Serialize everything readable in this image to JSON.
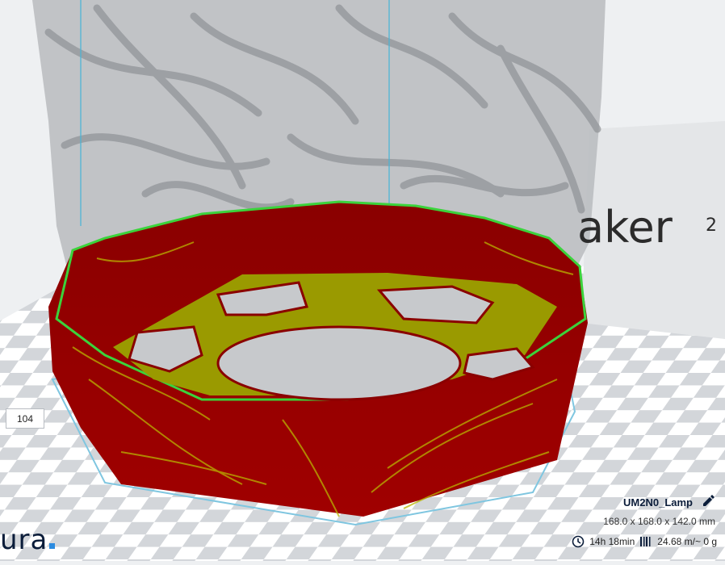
{
  "viewport": {
    "printer_brand_text": "aker",
    "printer_model_superscript": "2",
    "colors": {
      "wall": "#8a0000",
      "infill": "#9a9a00",
      "edge_green": "#3bd33b",
      "build_plate_light": "#ffffff",
      "build_plate_dark": "#d3d6da"
    }
  },
  "layer_view": {
    "current_layer": "104"
  },
  "brand": {
    "logo_text": "ura"
  },
  "job": {
    "name": "UM2N0_Lamp",
    "dimensions": "168.0 x 168.0 x 142.0 mm",
    "print_time": "14h 18min",
    "material": "24.68 m/~ 0 g",
    "icons": [
      "edit-icon",
      "clock-icon",
      "filament-icon"
    ]
  }
}
